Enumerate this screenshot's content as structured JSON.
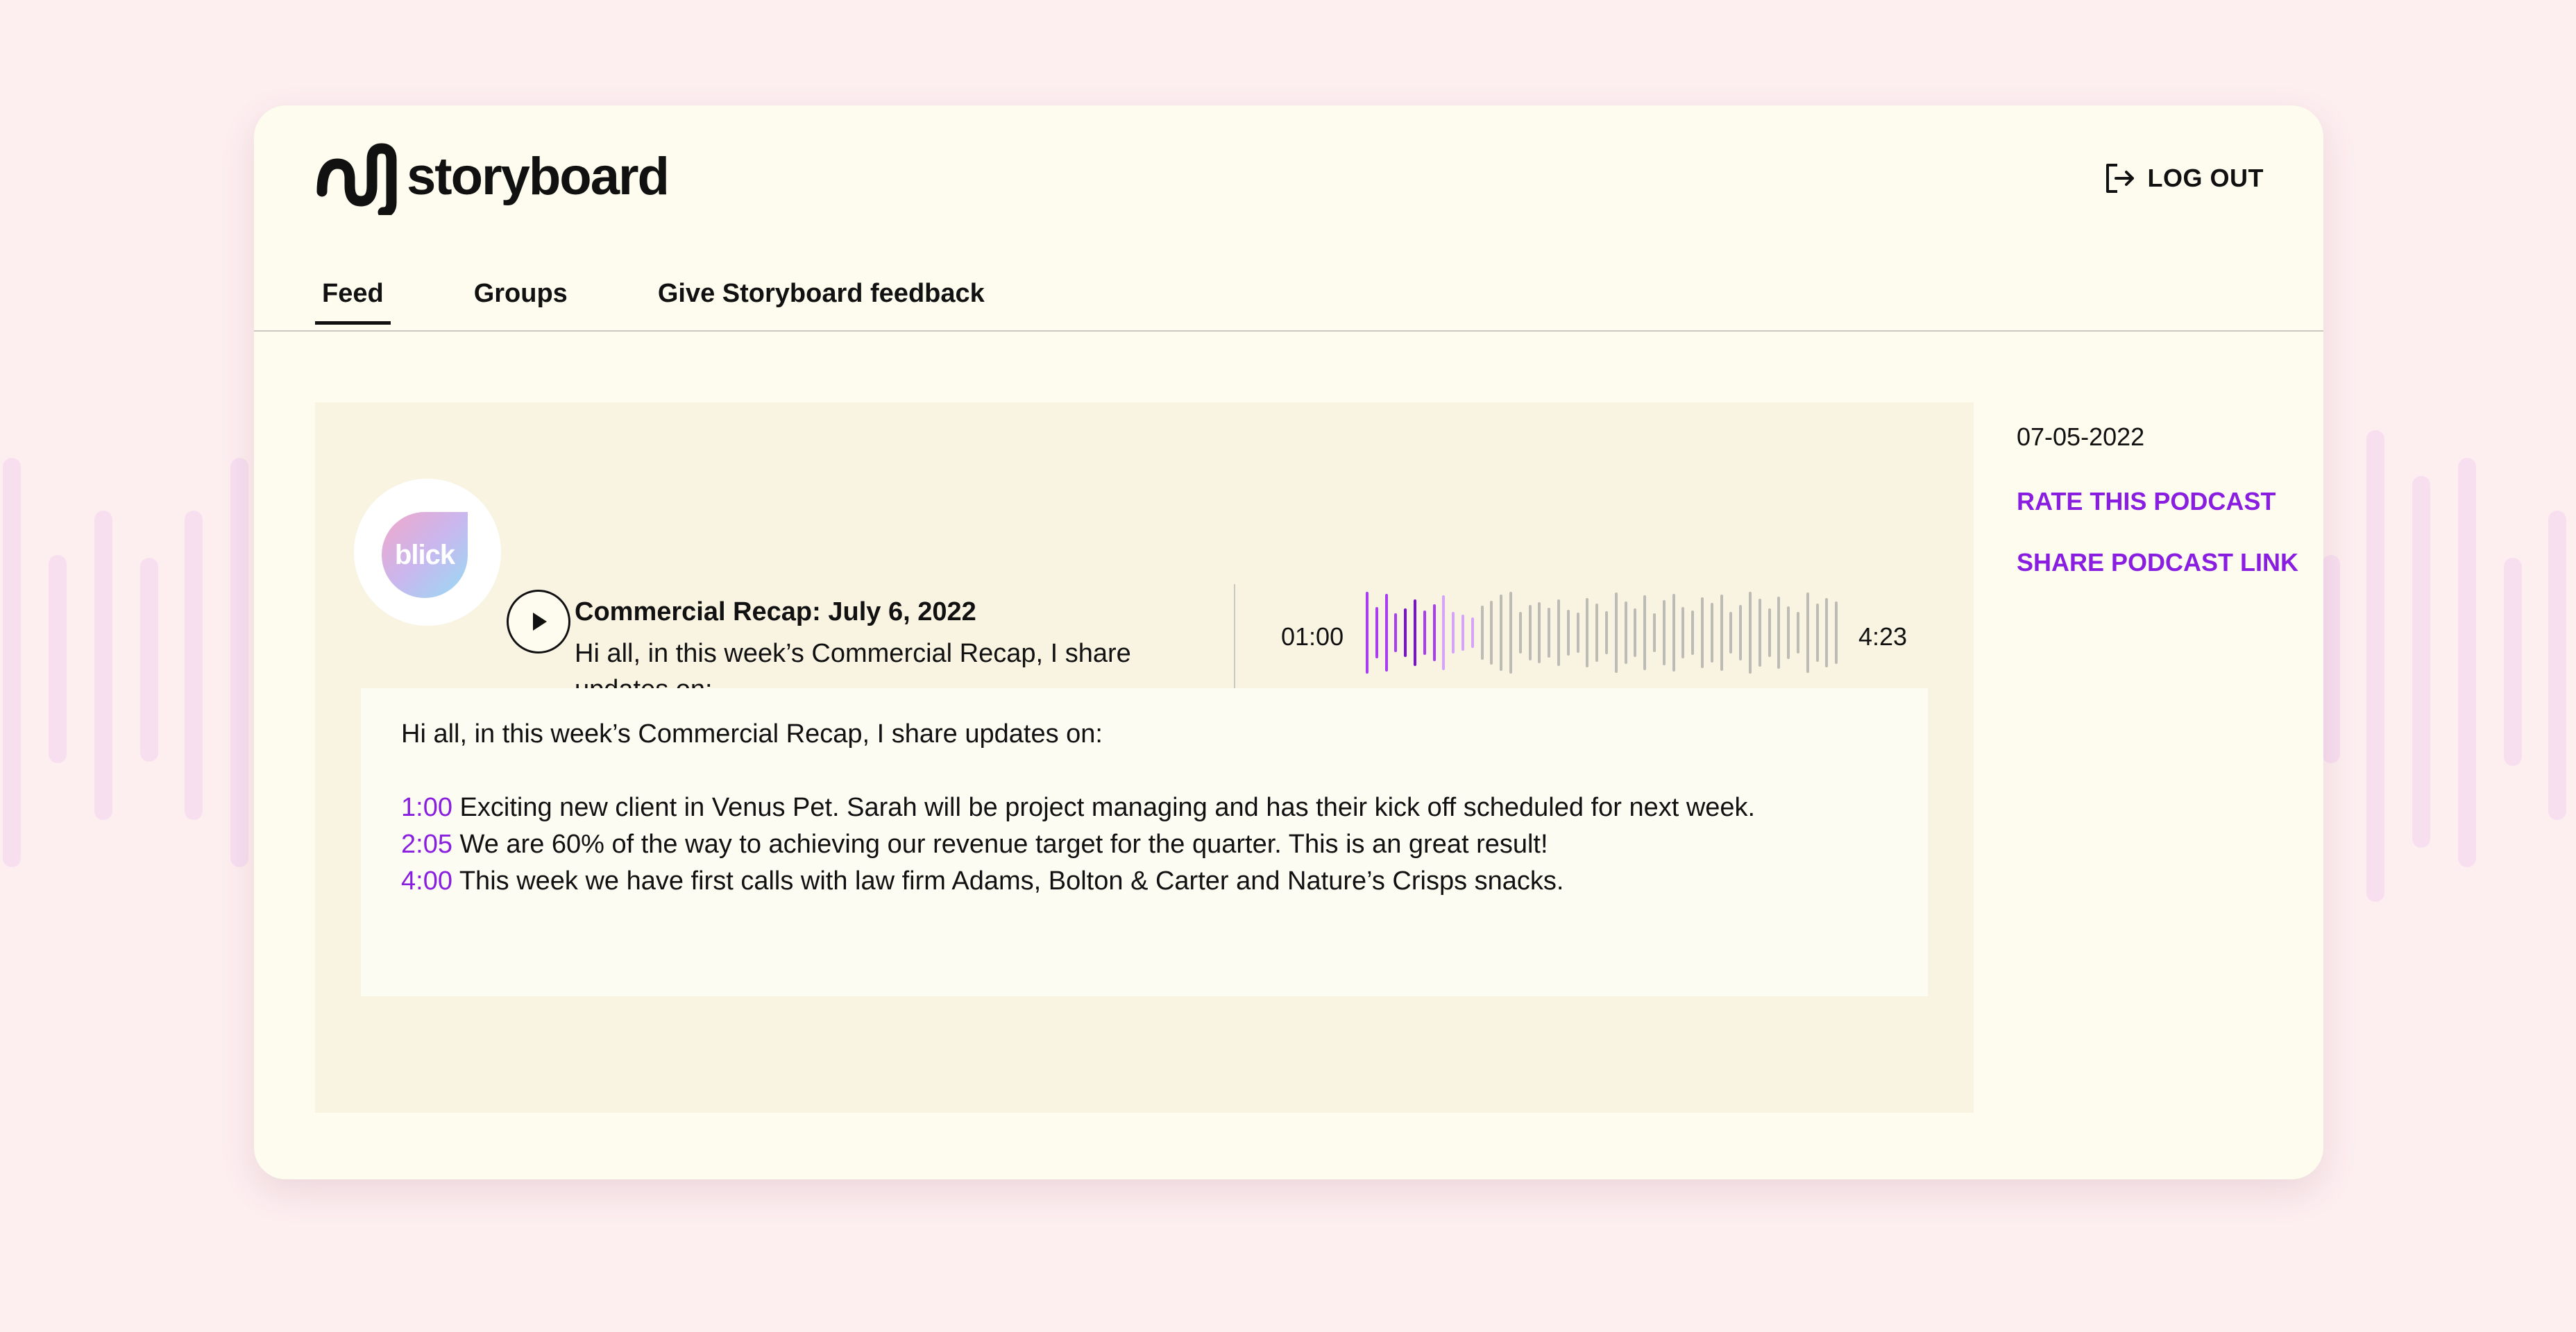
{
  "app": {
    "name": "storyboard"
  },
  "header": {
    "logout_label": "LOG OUT"
  },
  "nav": {
    "tabs": [
      {
        "label": "Feed",
        "active": true
      },
      {
        "label": "Groups",
        "active": false
      },
      {
        "label": "Give Storyboard feedback",
        "active": false
      }
    ]
  },
  "episode": {
    "brand": "blick",
    "title": "Commercial Recap: July 6, 2022",
    "snippet": "Hi all, in this week’s Commercial Recap, I share updates on:...",
    "current_time": "01:00",
    "total_time": "4:23",
    "progress_fraction": 0.23,
    "description_intro": "Hi all, in this week’s Commercial Recap, I share updates on:",
    "chapters": [
      {
        "time": "1:00",
        "text": "Exciting new client in Venus Pet. Sarah will be project managing and has their kick off scheduled for next week."
      },
      {
        "time": "2:05",
        "text": "We are 60% of the way to achieving our revenue target for the quarter. This is an great result!"
      },
      {
        "time": "4:00",
        "text": "This week we have first calls with law firm Adams, Bolton & Carter and Nature’s Crisps snacks."
      }
    ]
  },
  "sidebar": {
    "date": "07-05-2022",
    "rate_label": "RATE THIS PODCAST",
    "share_label": "SHARE PODCAST LINK"
  },
  "colors": {
    "accent": "#8a1ee0",
    "page_background": "#fdeef0",
    "card_background": "#fdfcee",
    "panel_background": "#f9f3e2",
    "waveform_played": "#a83ef0",
    "waveform_unplayed": "#bcbcb4",
    "decor_bars": "#f7dff0"
  },
  "icons": {
    "logo": "storyboard-wave-logo",
    "logout": "logout-icon",
    "play": "play-icon"
  }
}
